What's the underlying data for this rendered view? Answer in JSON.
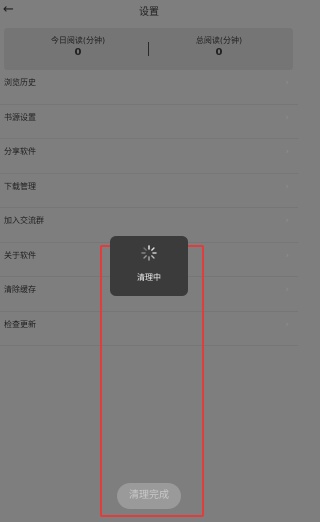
{
  "header": {
    "back_icon": "arrow-left-icon",
    "title": "设置"
  },
  "stats": {
    "today": {
      "label": "今日阅读(分钟)",
      "value": "0"
    },
    "total": {
      "label": "总阅读(分钟)",
      "value": "0"
    }
  },
  "menu": {
    "items": [
      {
        "label": "浏览历史"
      },
      {
        "label": "书源设置"
      },
      {
        "label": "分享软件"
      },
      {
        "label": "下载管理"
      },
      {
        "label": "加入交流群"
      },
      {
        "label": "关于软件"
      },
      {
        "label": "清除缓存"
      },
      {
        "label": "检查更新"
      }
    ],
    "chevron_icon": "chevron-right-icon"
  },
  "toast": {
    "icon": "loading-spinner-icon",
    "message": "清理中"
  },
  "complete_button": {
    "label": "清理完成"
  },
  "colors": {
    "overlay_bg": "#7e7e7e",
    "toast_bg": "#3b3b3b",
    "highlight": "#e23c3c"
  }
}
